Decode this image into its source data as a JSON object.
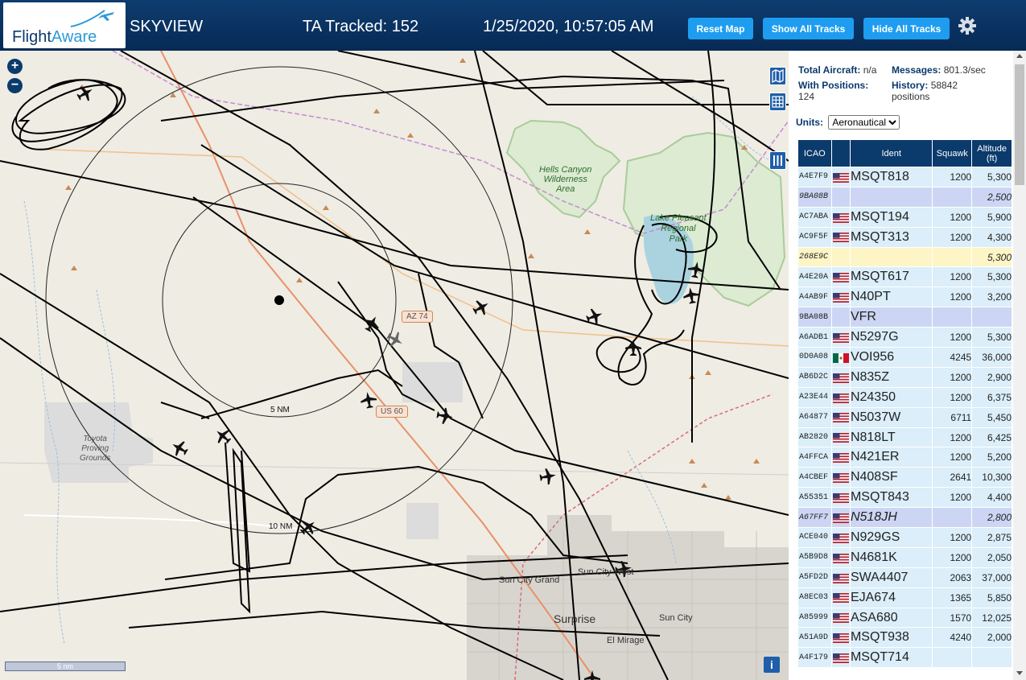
{
  "header": {
    "logo_text_1": "Flight",
    "logo_text_2": "Aware",
    "app_title": "SKYVIEW",
    "tracked": "TA Tracked: 152",
    "datetime": "1/25/2020, 10:57:05 AM",
    "reset_label": "Reset Map",
    "show_label": "Show All Tracks",
    "hide_label": "Hide All Tracks",
    "settings_icon": "gear-icon"
  },
  "map": {
    "labels": {
      "hells_canyon": "Hells Canyon\nWilderness\nArea",
      "lake_pleasant": "Lake Pleasant\nRegional\nPark",
      "toyota": "Toyota\nProving\nGrounds",
      "sun_city_grand": "Sun City Grand",
      "sun_city_west": "Sun City West",
      "surprise": "Surprise",
      "sun_city": "Sun City",
      "el_mirage": "El Mirage",
      "ring_5nm": "5 NM",
      "ring_10nm": "10 NM",
      "az74": "AZ 74",
      "us60": "US 60"
    },
    "scale_label": "5 nm",
    "info_label": "i"
  },
  "panel": {
    "total_aircraft_label": "Total Aircraft:",
    "total_aircraft_value": "n/a",
    "messages_label": "Messages:",
    "messages_value": "801.3/sec",
    "with_positions_label": "With Positions:",
    "with_positions_value": "124",
    "history_label": "History:",
    "history_value": "58842 positions",
    "units_label": "Units:",
    "units_value": "Aeronautical",
    "columns": [
      "ICAO",
      "",
      "Ident",
      "Squawk",
      "Altitude (ft)"
    ],
    "rows": [
      {
        "icao": "A4E7F9",
        "flag": "us",
        "ident": "MSQT818",
        "squawk": "1200",
        "alt": "5,300",
        "style": "normal"
      },
      {
        "icao": "9BA08B",
        "flag": "",
        "ident": "",
        "squawk": "",
        "alt": "2,500",
        "style": "alt"
      },
      {
        "icao": "AC7ABA",
        "flag": "us",
        "ident": "MSQT194",
        "squawk": "1200",
        "alt": "5,900",
        "style": "normal"
      },
      {
        "icao": "AC9F5F",
        "flag": "us",
        "ident": "MSQT313",
        "squawk": "1200",
        "alt": "4,300",
        "style": "normal"
      },
      {
        "icao": "268E9C",
        "flag": "",
        "ident": "",
        "squawk": "",
        "alt": "5,300",
        "style": "sel"
      },
      {
        "icao": "A4E20A",
        "flag": "us",
        "ident": "MSQT617",
        "squawk": "1200",
        "alt": "5,300",
        "style": "normal"
      },
      {
        "icao": "A4AB9F",
        "flag": "us",
        "ident": "N40PT",
        "squawk": "1200",
        "alt": "3,200",
        "style": "normal"
      },
      {
        "icao": "9BA08B",
        "flag": "",
        "ident": "VFR",
        "squawk": "",
        "alt": "",
        "style": "altn"
      },
      {
        "icao": "A6ADB1",
        "flag": "us",
        "ident": "N5297G",
        "squawk": "1200",
        "alt": "5,300",
        "style": "normal"
      },
      {
        "icao": "0D0A08",
        "flag": "mx",
        "ident": "VOI956",
        "squawk": "4245",
        "alt": "36,000",
        "style": "normal"
      },
      {
        "icao": "AB6D2C",
        "flag": "us",
        "ident": "N835Z",
        "squawk": "1200",
        "alt": "2,900",
        "style": "normal"
      },
      {
        "icao": "A23E44",
        "flag": "us",
        "ident": "N24350",
        "squawk": "1200",
        "alt": "6,375",
        "style": "normal"
      },
      {
        "icao": "A64877",
        "flag": "us",
        "ident": "N5037W",
        "squawk": "6711",
        "alt": "5,450",
        "style": "normal"
      },
      {
        "icao": "AB2820",
        "flag": "us",
        "ident": "N818LT",
        "squawk": "1200",
        "alt": "6,425",
        "style": "normal"
      },
      {
        "icao": "A4FFCA",
        "flag": "us",
        "ident": "N421ER",
        "squawk": "1200",
        "alt": "5,200",
        "style": "normal"
      },
      {
        "icao": "A4CBEF",
        "flag": "us",
        "ident": "N408SF",
        "squawk": "2641",
        "alt": "10,300",
        "style": "normal"
      },
      {
        "icao": "A55351",
        "flag": "us",
        "ident": "MSQT843",
        "squawk": "1200",
        "alt": "4,400",
        "style": "normal"
      },
      {
        "icao": "A67FF7",
        "flag": "us",
        "ident": "N518JH",
        "squawk": "",
        "alt": "2,800",
        "style": "alt"
      },
      {
        "icao": "ACE040",
        "flag": "us",
        "ident": "N929GS",
        "squawk": "1200",
        "alt": "2,875",
        "style": "normal"
      },
      {
        "icao": "A5B9D8",
        "flag": "us",
        "ident": "N4681K",
        "squawk": "1200",
        "alt": "2,050",
        "style": "normal"
      },
      {
        "icao": "A5FD2D",
        "flag": "us",
        "ident": "SWA4407",
        "squawk": "2063",
        "alt": "37,000",
        "style": "normal"
      },
      {
        "icao": "A8EC03",
        "flag": "us",
        "ident": "EJA674",
        "squawk": "1365",
        "alt": "5,850",
        "style": "normal"
      },
      {
        "icao": "A85999",
        "flag": "us",
        "ident": "ASA680",
        "squawk": "1570",
        "alt": "12,025",
        "style": "normal"
      },
      {
        "icao": "A51A9D",
        "flag": "us",
        "ident": "MSQT938",
        "squawk": "4240",
        "alt": "2,000",
        "style": "normal"
      },
      {
        "icao": "A4F179",
        "flag": "us",
        "ident": "MSQT714",
        "squawk": "",
        "alt": "",
        "style": "normal"
      }
    ]
  }
}
